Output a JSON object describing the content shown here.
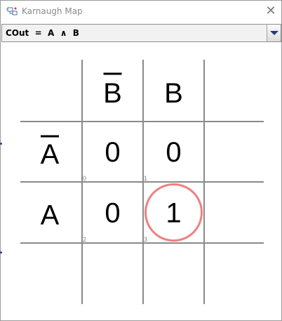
{
  "window": {
    "title": "Karnaugh Map",
    "close_glyph": "✕",
    "app_icon": "circuit-icon"
  },
  "selector": {
    "value": "COut  =  A  ∧  B"
  },
  "kmap": {
    "column_headers": [
      "B",
      "B"
    ],
    "column_overbar": [
      true,
      false
    ],
    "row_headers": [
      "A",
      "A"
    ],
    "row_overbar": [
      true,
      false
    ],
    "cells": [
      {
        "value": "0",
        "index": "0"
      },
      {
        "value": "0",
        "index": "1"
      },
      {
        "value": "0",
        "index": "2"
      },
      {
        "value": "1",
        "index": "3"
      }
    ],
    "highlight_color": "#f08080",
    "grid_color": "#8a8a8a"
  }
}
